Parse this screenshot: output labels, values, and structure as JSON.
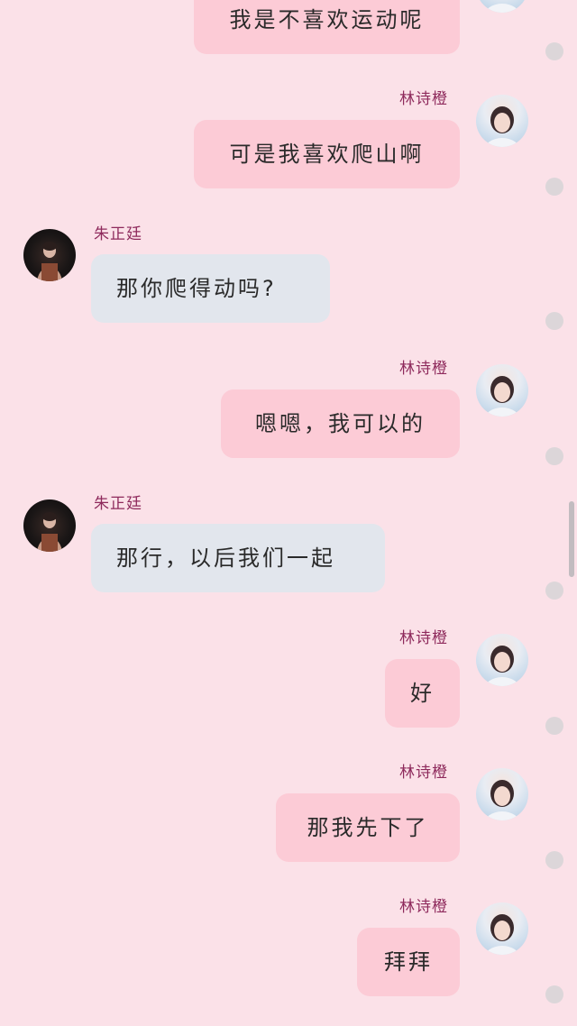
{
  "chat": {
    "messages": [
      {
        "sender": "",
        "side": "right",
        "text": "我是不喜欢运动呢"
      },
      {
        "sender": "林诗橙",
        "side": "right",
        "text": "可是我喜欢爬山啊"
      },
      {
        "sender": "朱正廷",
        "side": "left",
        "text": "那你爬得动吗?"
      },
      {
        "sender": "林诗橙",
        "side": "right",
        "text": "嗯嗯，我可以的"
      },
      {
        "sender": "朱正廷",
        "side": "left",
        "text": "那行，以后我们一起"
      },
      {
        "sender": "林诗橙",
        "side": "right",
        "text": "好"
      },
      {
        "sender": "林诗橙",
        "side": "right",
        "text": "那我先下了"
      },
      {
        "sender": "林诗橙",
        "side": "right",
        "text": "拜拜"
      }
    ]
  },
  "colors": {
    "background": "#fbe1e8",
    "my_bubble": "#fccbd6",
    "their_bubble": "#e2e6ed",
    "sender_name": "#8e2a5c"
  },
  "icons": {
    "girl_avatar": "avatar-girl",
    "boy_avatar": "avatar-boy",
    "status": "read-status-dot"
  }
}
